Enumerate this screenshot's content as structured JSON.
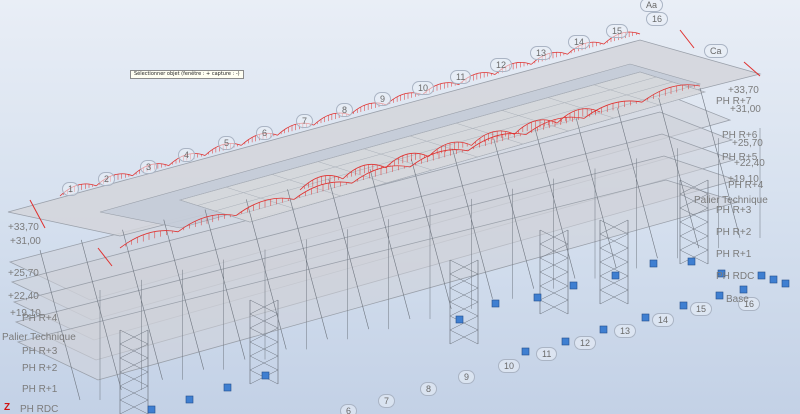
{
  "tooltip": "Sélectionner objet (fenêtre : + capture : -)",
  "axes_top": [
    "1",
    "2",
    "3",
    "4",
    "5",
    "6",
    "7",
    "8",
    "9",
    "10",
    "11",
    "12",
    "13",
    "14",
    "15",
    "16"
  ],
  "axes_bottom": [
    "6",
    "7",
    "8",
    "9",
    "10",
    "11",
    "12",
    "13",
    "14",
    "15",
    "16"
  ],
  "axis_letters": {
    "top": "Aa",
    "side": "Ca"
  },
  "levels_left": [
    "+33,70",
    "+31,00",
    "+25,70",
    "+22,40",
    "+19,10",
    "Palier Technique",
    "PH R+4",
    "PH R+3",
    "PH R+2",
    "PH R+1",
    "PH RDC"
  ],
  "levels_right": [
    "+33,70",
    "PH R+7",
    "+31,00",
    "PH R+6",
    "+25,70",
    "PH R+5",
    "+22,40",
    "+19,10",
    "PH R+4",
    "Palier Technique",
    "PH R+3",
    "PH R+2",
    "PH R+1",
    "PH RDC",
    "Base"
  ],
  "axis_z": "Z",
  "colors": {
    "slab": "#cfd2d8",
    "slab_edge": "#9aa0aa",
    "steel": "#6f7680",
    "load": "#e0302e",
    "support": "#3f7fd1"
  }
}
